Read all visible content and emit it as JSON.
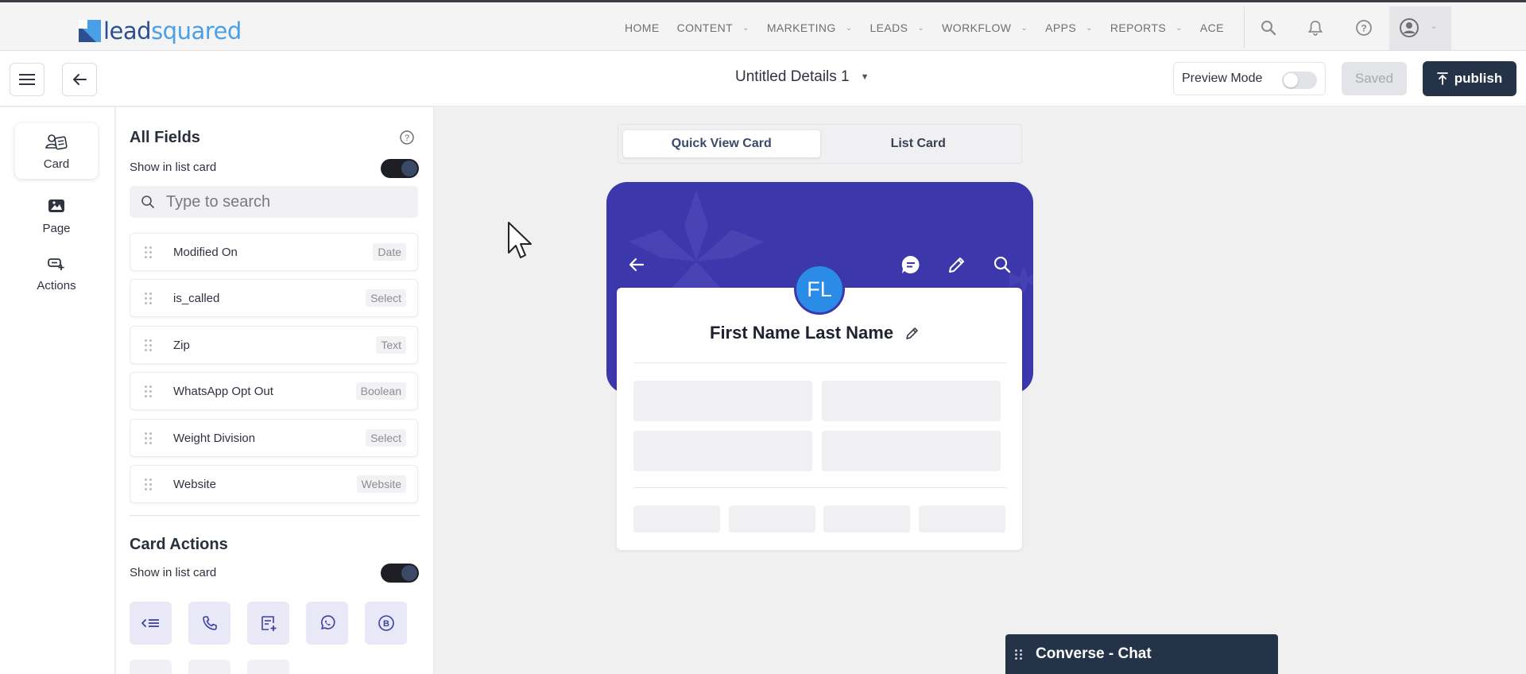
{
  "brand": {
    "logo_lead": "lead",
    "logo_squared": "squared",
    "logo_color": "#2d4f8f",
    "logo_accent": "#4aa0e6"
  },
  "nav": {
    "items": [
      {
        "label": "HOME",
        "dropdown": false
      },
      {
        "label": "CONTENT",
        "dropdown": true
      },
      {
        "label": "MARKETING",
        "dropdown": true
      },
      {
        "label": "LEADS",
        "dropdown": true
      },
      {
        "label": "WORKFLOW",
        "dropdown": true
      },
      {
        "label": "APPS",
        "dropdown": true
      },
      {
        "label": "REPORTS",
        "dropdown": true
      },
      {
        "label": "ACE",
        "dropdown": false
      }
    ],
    "icons": [
      "search-icon",
      "bell-icon",
      "help-icon",
      "user-icon"
    ]
  },
  "toolbar": {
    "title": "Untitled Details 1",
    "preview_label": "Preview Mode",
    "preview_on": false,
    "saved_label": "Saved",
    "publish_label": "publish",
    "publish_color": "#243347"
  },
  "rail": {
    "items": [
      {
        "label": "Card",
        "icon": "card-icon",
        "active": true
      },
      {
        "label": "Page",
        "icon": "page-icon",
        "active": false
      },
      {
        "label": "Actions",
        "icon": "actions-icon",
        "active": false
      }
    ]
  },
  "fields_panel": {
    "title": "All Fields",
    "show_in_list_label": "Show in list card",
    "show_in_list_on": true,
    "search_placeholder": "Type to search",
    "fields": [
      {
        "name": "Modified On",
        "type": "Date"
      },
      {
        "name": "is_called",
        "type": "Select"
      },
      {
        "name": "Zip",
        "type": "Text"
      },
      {
        "name": "WhatsApp Opt Out",
        "type": "Boolean"
      },
      {
        "name": "Weight Division",
        "type": "Select"
      },
      {
        "name": "Website",
        "type": "Website"
      }
    ]
  },
  "card_actions": {
    "title": "Card Actions",
    "show_in_list_label": "Show in list card",
    "show_in_list_on": true,
    "buttons": [
      "list-action-icon",
      "phone-icon",
      "add-note-icon",
      "whatsapp-icon",
      "b-icon"
    ]
  },
  "canvas": {
    "tabs": [
      {
        "label": "Quick View Card",
        "active": true
      },
      {
        "label": "List Card",
        "active": false
      }
    ],
    "header_color": "#3c37aa",
    "avatar_initials": "FL",
    "avatar_color": "#2b8ce8",
    "lead_name": "First Name Last Name",
    "header_icons": [
      "back-arrow-icon",
      "chat-icon",
      "edit-icon",
      "search-icon"
    ]
  },
  "chat": {
    "label": "Converse - Chat"
  }
}
